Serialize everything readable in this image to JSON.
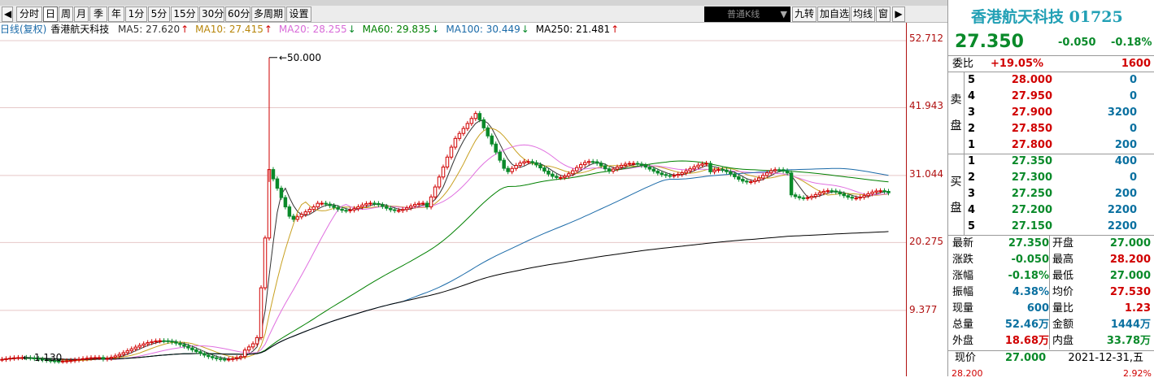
{
  "toolbar": {
    "buttons": [
      "分时",
      "日",
      "周",
      "月",
      "季",
      "年",
      "1分",
      "5分",
      "15分",
      "30分",
      "60分",
      "多周期",
      "设置"
    ],
    "active": "日",
    "chart_type": "普通K线",
    "right_buttons": [
      "九转",
      "加自选",
      "均线",
      "窗"
    ]
  },
  "ma": {
    "prefix": "日线(复权)",
    "name": "香港航天科技",
    "items": [
      {
        "label": "MA5: 27.620",
        "arrow": "↑",
        "color": "#333333",
        "arrow_color": "#d00000"
      },
      {
        "label": "MA10: 27.415",
        "arrow": "↑",
        "color": "#b8860b",
        "arrow_color": "#d00000"
      },
      {
        "label": "MA20: 28.255",
        "arrow": "↓",
        "color": "#d86ad8",
        "arrow_color": "#0a8a2a"
      },
      {
        "label": "MA60: 29.835",
        "arrow": "↓",
        "color": "#008000",
        "arrow_color": "#0a8a2a"
      },
      {
        "label": "MA100: 30.449",
        "arrow": "↓",
        "color": "#1a6aa8",
        "arrow_color": "#0a8a2a"
      },
      {
        "label": "MA250: 21.481",
        "arrow": "↑",
        "color": "#000000",
        "arrow_color": "#d00000"
      }
    ]
  },
  "chart_data": {
    "type": "candlestick",
    "yaxis_ticks": [
      "52.712",
      "41.943",
      "31.044",
      "20.275",
      "9.377"
    ],
    "high_label": "50.000",
    "low_label": "1.130",
    "ylim": [
      1.13,
      52.712
    ]
  },
  "panel": {
    "title": "香港航天科技 01725",
    "price": "27.350",
    "change": "-0.050",
    "change_pct": "-0.18%",
    "weibi": {
      "label": "委比",
      "value": "+19.05%",
      "diff": "1600"
    },
    "sell_side_label": "卖盘",
    "buy_side_label": "买盘",
    "sell": [
      {
        "level": "5",
        "price": "28.000",
        "vol": "0"
      },
      {
        "level": "4",
        "price": "27.950",
        "vol": "0"
      },
      {
        "level": "3",
        "price": "27.900",
        "vol": "3200"
      },
      {
        "level": "2",
        "price": "27.850",
        "vol": "0"
      },
      {
        "level": "1",
        "price": "27.800",
        "vol": "200"
      }
    ],
    "buy": [
      {
        "level": "1",
        "price": "27.350",
        "vol": "400"
      },
      {
        "level": "2",
        "price": "27.300",
        "vol": "0"
      },
      {
        "level": "3",
        "price": "27.250",
        "vol": "200"
      },
      {
        "level": "4",
        "price": "27.200",
        "vol": "2200"
      },
      {
        "level": "5",
        "price": "27.150",
        "vol": "2200"
      }
    ],
    "stats": [
      {
        "l1": "最新",
        "v1": "27.350",
        "c1": "green",
        "l2": "开盘",
        "v2": "27.000",
        "c2": "green"
      },
      {
        "l1": "涨跌",
        "v1": "-0.050",
        "c1": "green",
        "l2": "最高",
        "v2": "28.200",
        "c2": "red"
      },
      {
        "l1": "涨幅",
        "v1": "-0.18%",
        "c1": "green",
        "l2": "最低",
        "v2": "27.000",
        "c2": "green"
      },
      {
        "l1": "振幅",
        "v1": "4.38%",
        "c1": "blue",
        "l2": "均价",
        "v2": "27.530",
        "c2": "red"
      },
      {
        "l1": "现量",
        "v1": "600",
        "c1": "blue",
        "l2": "量比",
        "v2": "1.23",
        "c2": "red"
      },
      {
        "l1": "总量",
        "v1": "52.46万",
        "c1": "blue",
        "l2": "金额",
        "v2": "1444万",
        "c2": "blue"
      },
      {
        "l1": "外盘",
        "v1": "18.68万",
        "c1": "red",
        "l2": "内盘",
        "v2": "33.78万",
        "c2": "green"
      }
    ],
    "bottom": {
      "label": "现价",
      "price": "27.000",
      "date": "2021-12-31,五",
      "left": "28.200",
      "right": "2.92%"
    }
  }
}
